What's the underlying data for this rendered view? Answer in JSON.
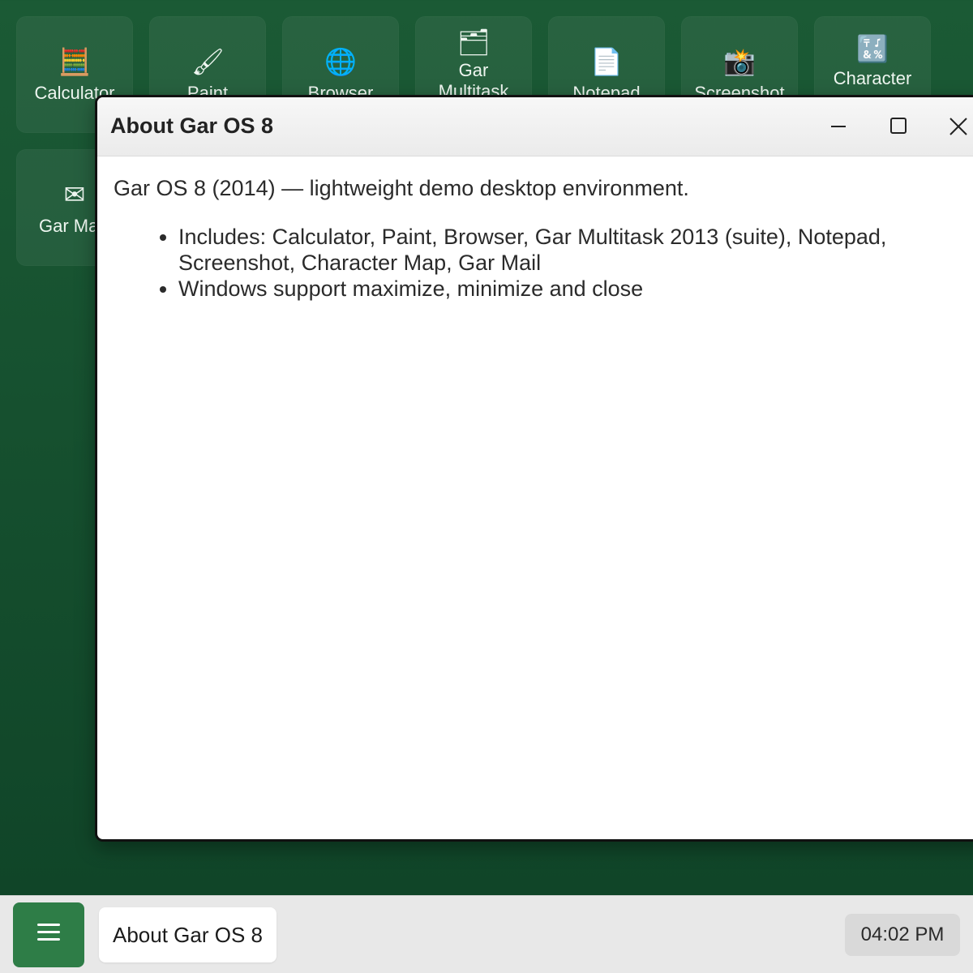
{
  "desktop": {
    "icons": [
      {
        "label": "Calculator",
        "icon": "calculator-icon",
        "glyph": "🧮"
      },
      {
        "label": "Paint",
        "icon": "paintbrush-icon",
        "glyph": "🖌"
      },
      {
        "label": "Browser",
        "icon": "globe-icon",
        "glyph": "🌐"
      },
      {
        "label": "Gar Multitask",
        "icon": "folder-icon",
        "glyph": "🗂"
      },
      {
        "label": "Notepad",
        "icon": "document-icon",
        "glyph": "📄"
      },
      {
        "label": "Screenshot",
        "icon": "camera-flash-icon",
        "glyph": "📸"
      },
      {
        "label": "Character",
        "icon": "symbols-icon",
        "glyph": "🔣"
      },
      {
        "label": "Gar Ma",
        "icon": "envelope-icon",
        "glyph": "✉"
      }
    ]
  },
  "window": {
    "title": "About Gar OS 8",
    "description": "Gar OS 8 (2014) — lightweight demo desktop environment.",
    "list": [
      "Includes: Calculator, Paint, Browser, Gar Multitask 2013 (suite), Notepad, Screenshot, Character Map, Gar Mail",
      "Windows support maximize, minimize and close"
    ]
  },
  "taskbar": {
    "task_label": "About Gar OS 8",
    "clock": "04:02 PM"
  },
  "colors": {
    "desktop_background": "#175030",
    "start_button": "#2e7d47",
    "taskbar": "#e8e8e8"
  }
}
